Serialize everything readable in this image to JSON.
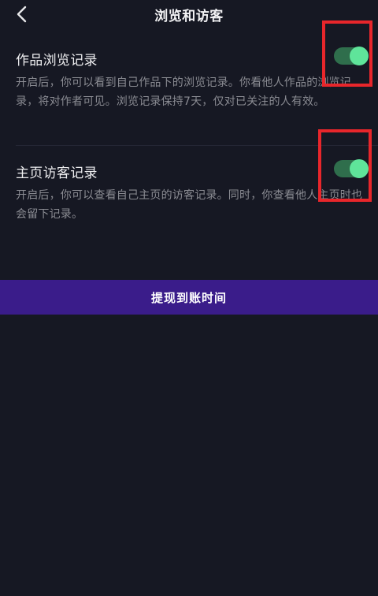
{
  "header": {
    "title": "浏览和访客",
    "back_icon": "chevron-left-icon"
  },
  "settings": [
    {
      "title": "作品浏览记录",
      "description": "开启后，你可以看到自己作品下的浏览记录。你看他人作品的浏览记录，将对作者可见。浏览记录保持7天，仅对已关注的人有效。",
      "enabled": true
    },
    {
      "title": "主页访客记录",
      "description": "开启后，你可以查看自己主页的访客记录。同时，你查看他人主页时也会留下记录。",
      "enabled": true
    }
  ],
  "banner": {
    "text": "提现到账时间"
  },
  "colors": {
    "background": "#161823",
    "toggle_track": "#2f6e4c",
    "toggle_knob": "#5fe49a",
    "highlight": "#e8262b",
    "banner": "#3a1c8a"
  }
}
